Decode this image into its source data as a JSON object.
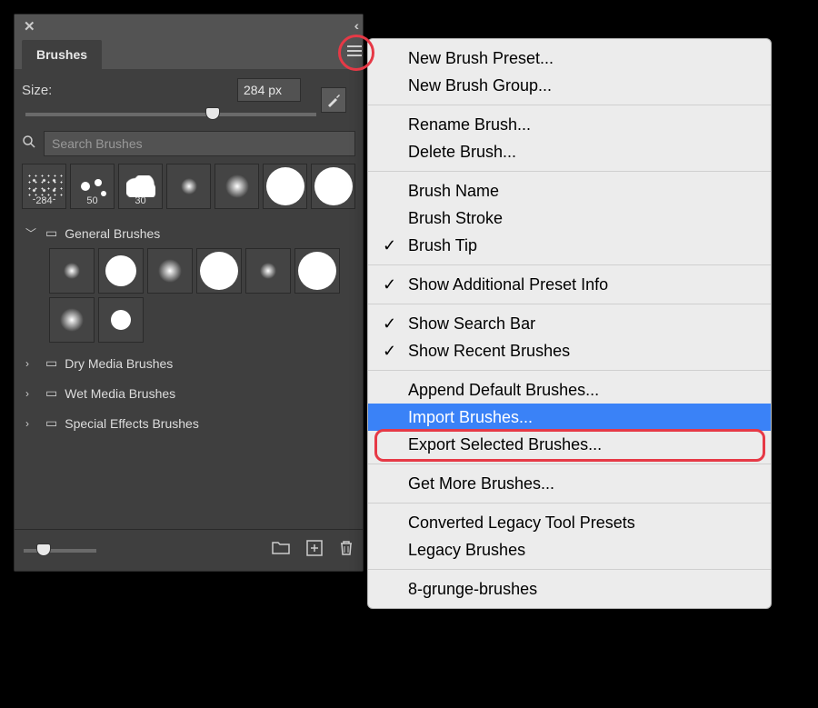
{
  "panel": {
    "tab_label": "Brushes",
    "size_label": "Size:",
    "size_value": "284 px",
    "search_placeholder": "Search Brushes",
    "recent": [
      {
        "label": "284"
      },
      {
        "label": "50"
      },
      {
        "label": "30"
      },
      {
        "label": ""
      },
      {
        "label": ""
      },
      {
        "label": ""
      },
      {
        "label": ""
      }
    ],
    "folder_open": "General Brushes",
    "folders": [
      "Dry Media Brushes",
      "Wet Media Brushes",
      "Special Effects Brushes"
    ]
  },
  "menu": {
    "items": [
      {
        "label": "New Brush Preset...",
        "checked": false
      },
      {
        "label": "New Brush Group...",
        "checked": false
      },
      {
        "sep": true
      },
      {
        "label": "Rename Brush...",
        "checked": false
      },
      {
        "label": "Delete Brush...",
        "checked": false
      },
      {
        "sep": true
      },
      {
        "label": "Brush Name",
        "checked": false
      },
      {
        "label": "Brush Stroke",
        "checked": false
      },
      {
        "label": "Brush Tip",
        "checked": true
      },
      {
        "sep": true
      },
      {
        "label": "Show Additional Preset Info",
        "checked": true
      },
      {
        "sep": true
      },
      {
        "label": "Show Search Bar",
        "checked": true
      },
      {
        "label": "Show Recent Brushes",
        "checked": true
      },
      {
        "sep": true
      },
      {
        "label": "Append Default Brushes...",
        "checked": false
      },
      {
        "label": "Import Brushes...",
        "checked": false,
        "highlight": true
      },
      {
        "label": "Export Selected Brushes...",
        "checked": false
      },
      {
        "sep": true
      },
      {
        "label": "Get More Brushes...",
        "checked": false
      },
      {
        "sep": true
      },
      {
        "label": "Converted Legacy Tool Presets",
        "checked": false
      },
      {
        "label": "Legacy Brushes",
        "checked": false
      },
      {
        "sep": true
      },
      {
        "label": "8-grunge-brushes",
        "checked": false
      }
    ]
  }
}
